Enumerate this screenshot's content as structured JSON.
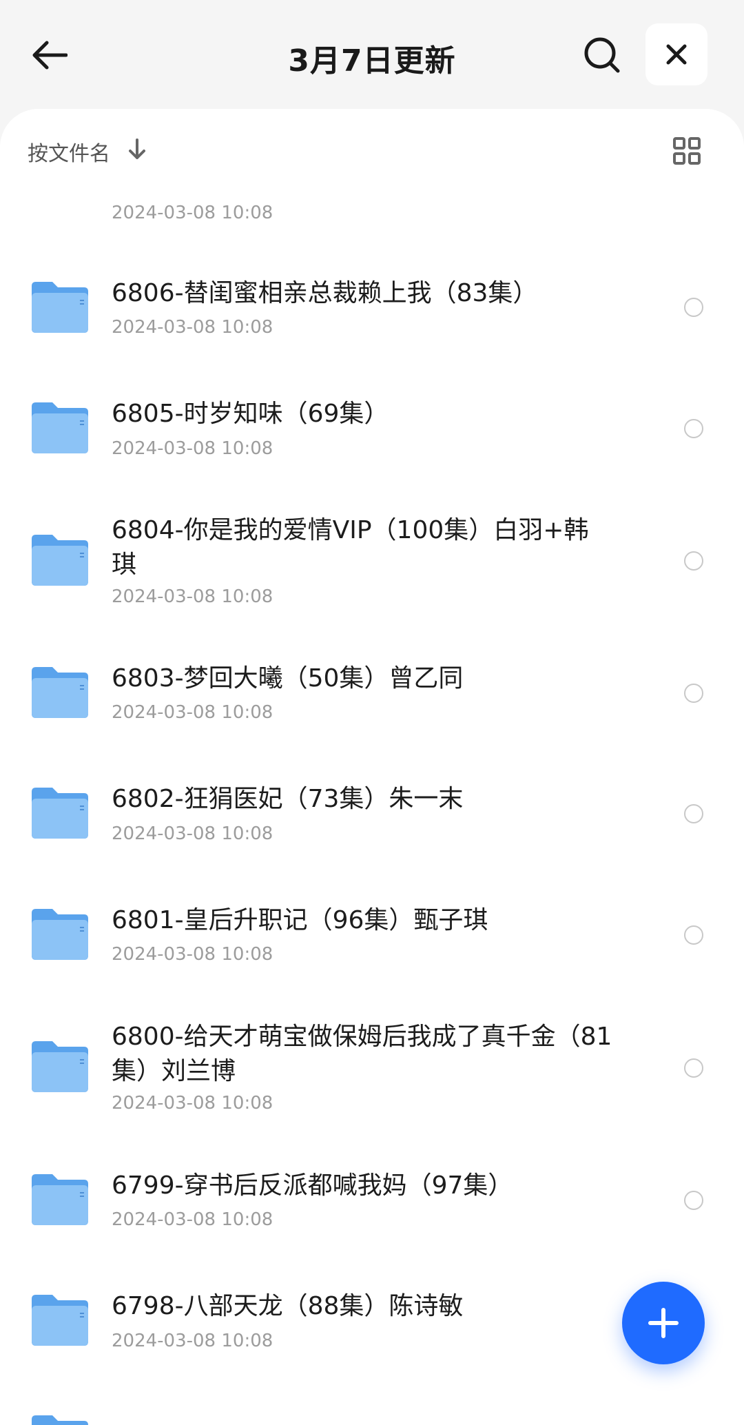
{
  "header": {
    "title": "3月7日更新"
  },
  "sort": {
    "label": "按文件名"
  },
  "files": [
    {
      "name": "",
      "date": "2024-03-08 10:08"
    },
    {
      "name": "6806-替闺蜜相亲总裁赖上我（83集）",
      "date": "2024-03-08 10:08"
    },
    {
      "name": "6805-时岁知味（69集）",
      "date": "2024-03-08 10:08"
    },
    {
      "name": "6804-你是我的爱情VIP（100集）白羽+韩琪",
      "date": "2024-03-08 10:08"
    },
    {
      "name": "6803-梦回大曦（50集）曾乙同",
      "date": "2024-03-08 10:08"
    },
    {
      "name": "6802-狂狷医妃（73集）朱一末",
      "date": "2024-03-08 10:08"
    },
    {
      "name": "6801-皇后升职记（96集）甄子琪",
      "date": "2024-03-08 10:08"
    },
    {
      "name": "6800-给天才萌宝做保姆后我成了真千金（81集）刘兰博",
      "date": "2024-03-08 10:08"
    },
    {
      "name": "6799-穿书后反派都喊我妈（97集）",
      "date": "2024-03-08 10:08"
    },
    {
      "name": "6798-八部天龙（88集）陈诗敏",
      "date": "2024-03-08 10:08"
    }
  ],
  "icons": {
    "back": "back-arrow-icon",
    "search": "search-icon",
    "close": "close-icon",
    "sort": "sort-down-arrow-icon",
    "view": "grid-view-icon",
    "folder": "folder-icon",
    "add": "plus-icon"
  },
  "colors": {
    "accent": "#1f6bff",
    "folder": "#7cb8f5"
  }
}
